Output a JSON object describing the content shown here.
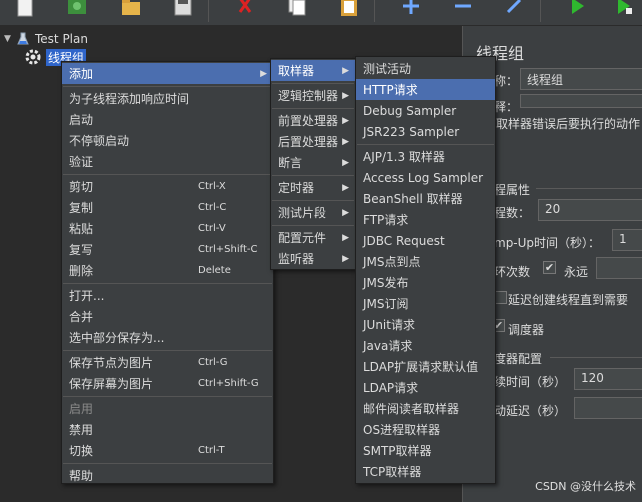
{
  "toolbar": {
    "buttons": [
      {
        "name": "new-icon"
      },
      {
        "name": "templates-icon"
      },
      {
        "name": "open-icon"
      },
      {
        "name": "save-icon"
      },
      {
        "name": "cut-icon"
      },
      {
        "name": "copy-icon"
      },
      {
        "name": "paste-icon"
      },
      {
        "name": "expand-icon"
      },
      {
        "name": "collapse-icon"
      },
      {
        "name": "toggle-icon"
      },
      {
        "name": "start-icon"
      },
      {
        "name": "start-no-pause-icon"
      }
    ]
  },
  "tree": {
    "root": "Test Plan",
    "child": "线程组"
  },
  "right_panel": {
    "title": "线程组",
    "name_label": "称：",
    "name_value": "线程组",
    "comment_label": "释：",
    "error_action_text": "取样器错误后要执行的动作",
    "thread_props_label": "程属性",
    "threads_label": "程数：",
    "threads_value": "20",
    "rampup_label": "mp-Up时间（秒）：",
    "rampup_value": "1",
    "loop_label": "环次数",
    "forever_label": "永远",
    "delay_create_label": "延迟创建线程直到需要",
    "scheduler_label": "调度器",
    "scheduler_config_label": "度器配置",
    "duration_label": "续时间（秒）",
    "duration_value": "120",
    "startup_delay_label": "动延迟（秒）"
  },
  "context_menu": {
    "items": [
      {
        "label": "添加",
        "submenu": true,
        "highlight": true
      },
      {
        "separator": true
      },
      {
        "label": "为子线程添加响应时间"
      },
      {
        "label": "启动"
      },
      {
        "label": "不停顿启动"
      },
      {
        "label": "验证"
      },
      {
        "separator": true
      },
      {
        "label": "剪切",
        "accel": "Ctrl-X"
      },
      {
        "label": "复制",
        "accel": "Ctrl-C"
      },
      {
        "label": "粘贴",
        "accel": "Ctrl-V"
      },
      {
        "label": "复写",
        "accel": "Ctrl+Shift-C"
      },
      {
        "label": "删除",
        "accel": "Delete"
      },
      {
        "separator": true
      },
      {
        "label": "打开..."
      },
      {
        "label": "合并"
      },
      {
        "label": "选中部分保存为..."
      },
      {
        "separator": true
      },
      {
        "label": "保存节点为图片",
        "accel": "Ctrl-G"
      },
      {
        "label": "保存屏幕为图片",
        "accel": "Ctrl+Shift-G"
      },
      {
        "separator": true
      },
      {
        "label": "启用",
        "disabled": true
      },
      {
        "label": "禁用"
      },
      {
        "label": "切换",
        "accel": "Ctrl-T"
      },
      {
        "separator": true
      },
      {
        "label": "帮助"
      }
    ]
  },
  "add_submenu": {
    "items": [
      {
        "label": "取样器",
        "highlight": true
      },
      {
        "separator": true
      },
      {
        "label": "逻辑控制器"
      },
      {
        "separator": true
      },
      {
        "label": "前置处理器"
      },
      {
        "label": "后置处理器"
      },
      {
        "label": "断言"
      },
      {
        "separator": true
      },
      {
        "label": "定时器"
      },
      {
        "separator": true
      },
      {
        "label": "测试片段"
      },
      {
        "separator": true
      },
      {
        "label": "配置元件"
      },
      {
        "label": "监听器"
      }
    ]
  },
  "sampler_submenu": {
    "items": [
      {
        "label": "测试活动"
      },
      {
        "label": "HTTP请求",
        "highlight": true
      },
      {
        "label": "Debug Sampler"
      },
      {
        "label": "JSR223 Sampler"
      },
      {
        "separator": true
      },
      {
        "label": "AJP/1.3 取样器"
      },
      {
        "label": "Access Log Sampler"
      },
      {
        "label": "BeanShell 取样器"
      },
      {
        "label": "FTP请求"
      },
      {
        "label": "JDBC Request"
      },
      {
        "label": "JMS点到点"
      },
      {
        "label": "JMS发布"
      },
      {
        "label": "JMS订阅"
      },
      {
        "label": "JUnit请求"
      },
      {
        "label": "Java请求"
      },
      {
        "label": "LDAP扩展请求默认值"
      },
      {
        "label": "LDAP请求"
      },
      {
        "label": "邮件阅读者取样器"
      },
      {
        "label": "OS进程取样器"
      },
      {
        "label": "SMTP取样器"
      },
      {
        "label": "TCP取样器"
      }
    ]
  },
  "watermark": "CSDN @没什么技术"
}
